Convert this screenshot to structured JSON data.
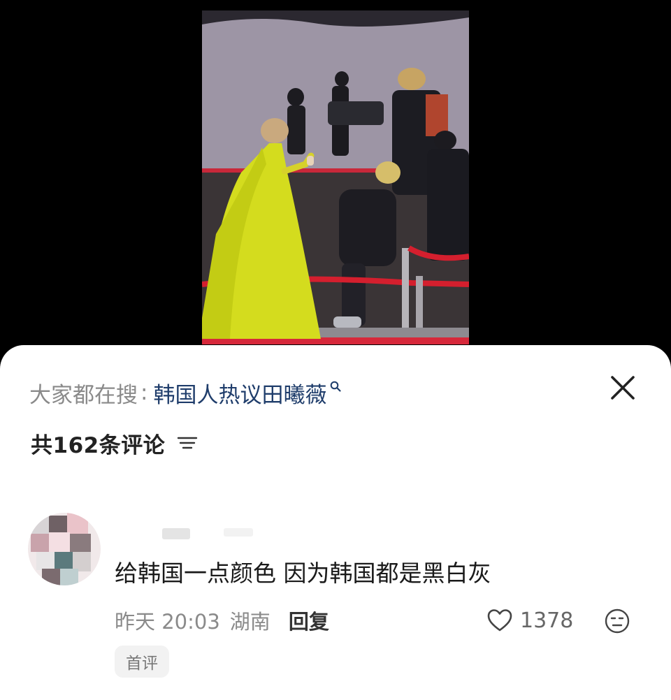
{
  "search": {
    "prefix": "大家都在搜",
    "colon": ":",
    "term": "韩国人热议田曦薇"
  },
  "comments_header": {
    "count_text": "共162条评论"
  },
  "comment": {
    "text": "给韩国一点颜色 因为韩国都是黑白灰",
    "time": "昨天 20:03",
    "location": "湖南",
    "reply_label": "回复",
    "likes": "1378",
    "badge": "首评"
  },
  "icons": {
    "close": "close-icon",
    "search": "search-icon",
    "sort": "sort-icon",
    "like": "heart-outline-icon",
    "emoji": "emoji-icon"
  },
  "colors": {
    "search_term": "#1f3d6b",
    "muted": "#8a8a8a",
    "sheet_bg": "#ffffff"
  }
}
